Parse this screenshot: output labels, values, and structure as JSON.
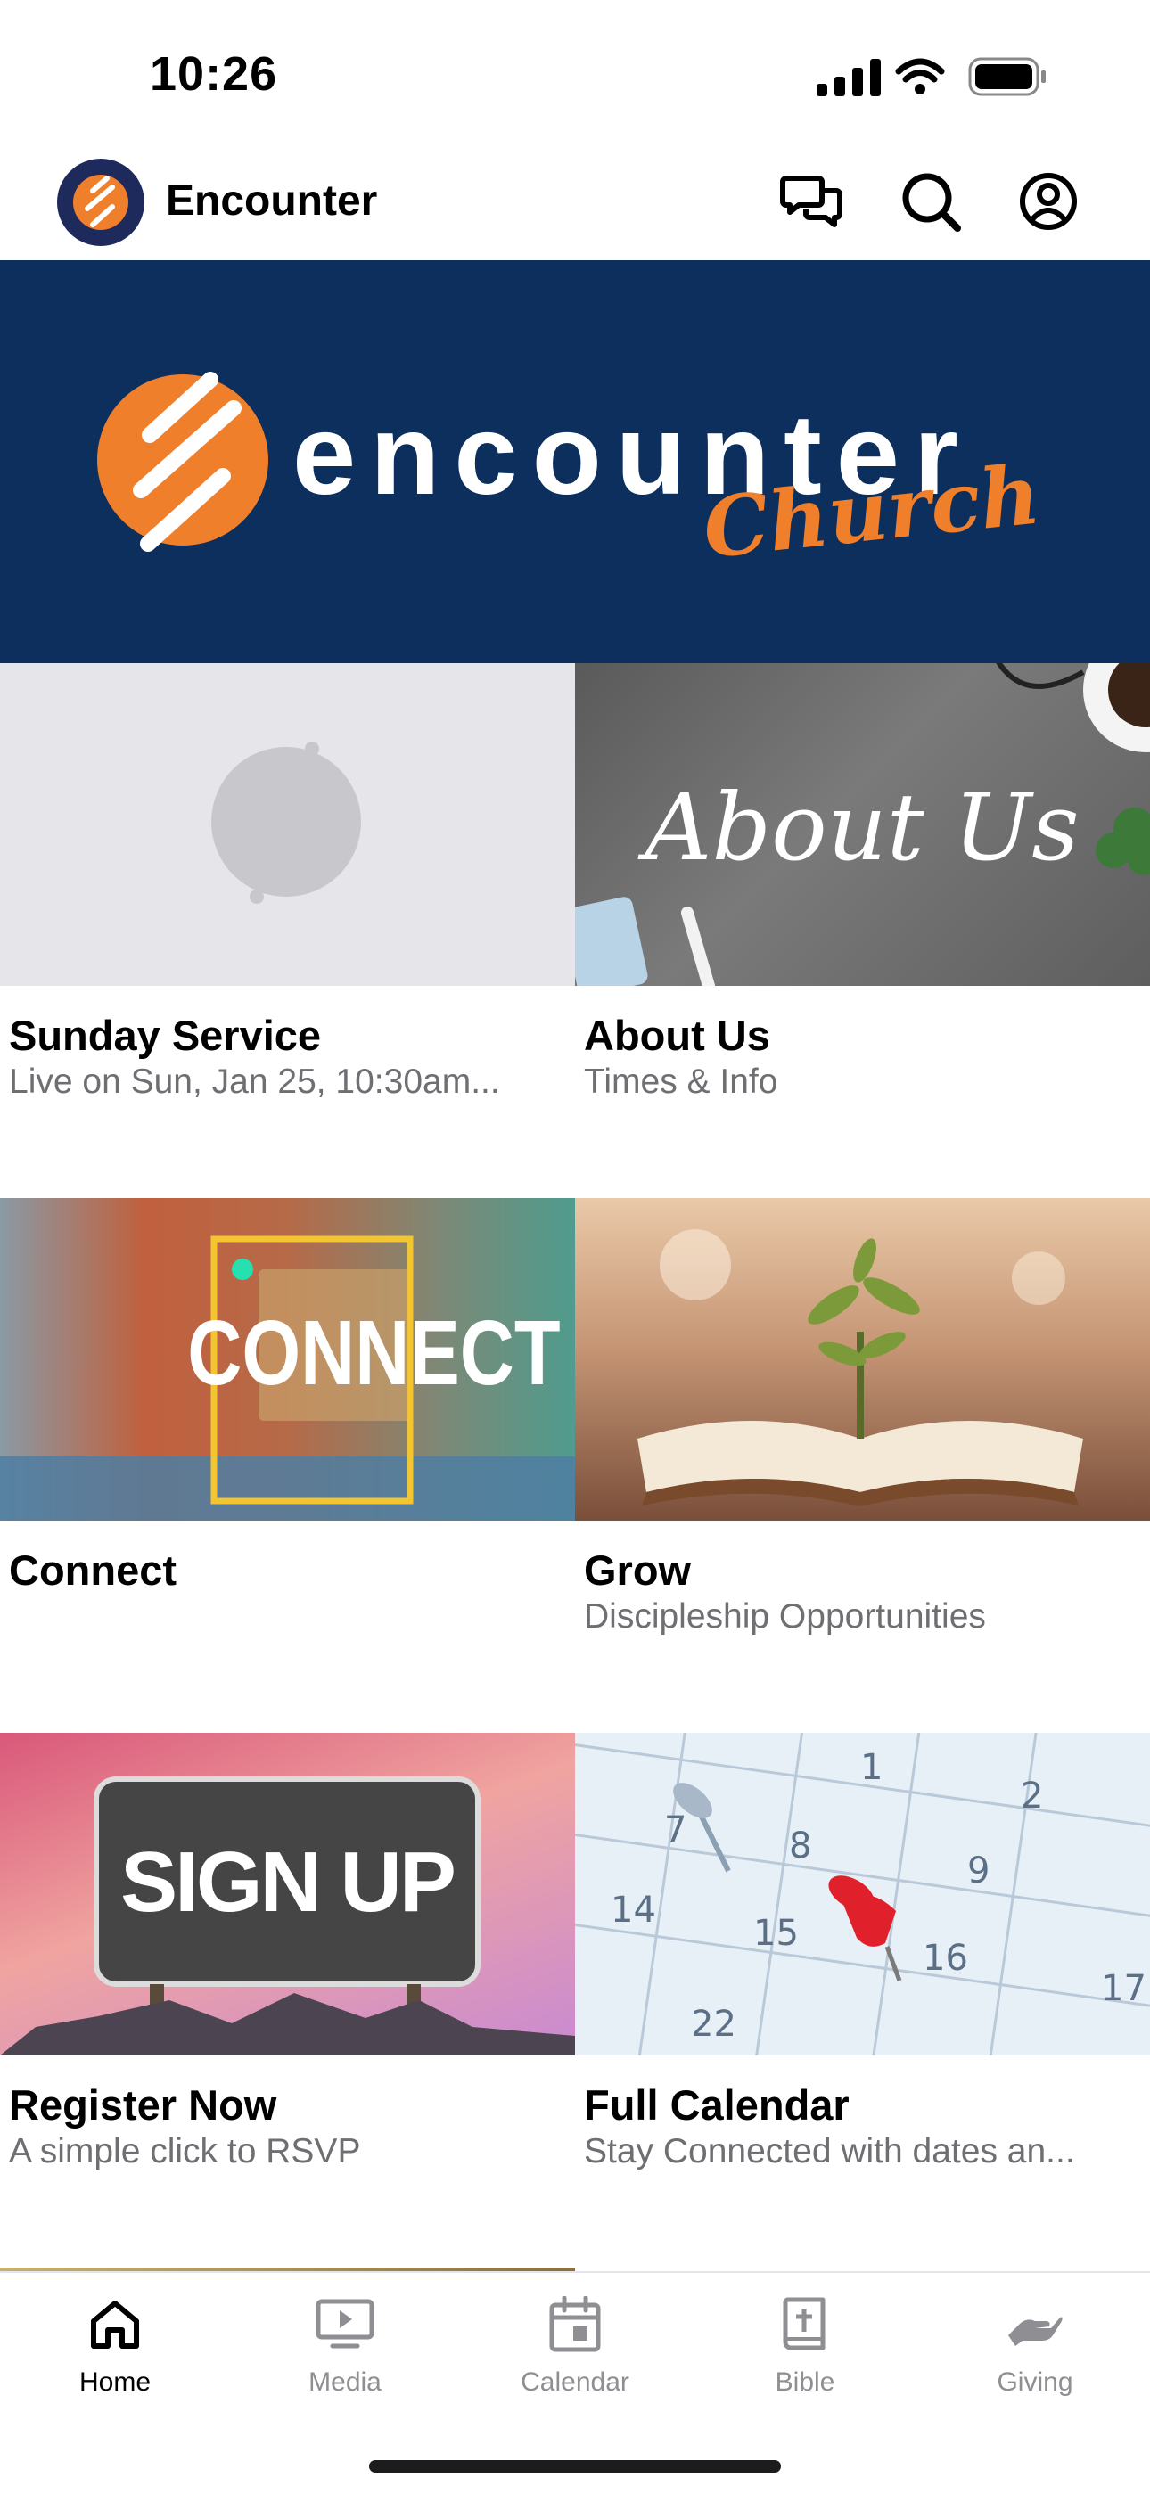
{
  "status_bar": {
    "time": "10:26"
  },
  "header": {
    "app_title": "Encounter"
  },
  "banner": {
    "word": "encounter",
    "script_word": "Church",
    "brand_orange": "#f07f2c",
    "brand_navy": "#0c2f5e"
  },
  "tiles": [
    {
      "title": "Sunday Service",
      "subtitle": "Live on Sun, Jan 25, 10:30am..."
    },
    {
      "title": "About Us",
      "subtitle": "Times & Info",
      "image_text": "About Us"
    },
    {
      "title": "Connect",
      "subtitle": "",
      "image_text": "CONNECT"
    },
    {
      "title": "Grow",
      "subtitle": "Discipleship Opportunities"
    },
    {
      "title": "Register Now",
      "subtitle": "A simple click to RSVP",
      "image_text": "SIGN UP"
    },
    {
      "title": "Full Calendar",
      "subtitle": "Stay Connected with dates an...",
      "calendar_numbers": [
        "1",
        "2",
        "7",
        "8",
        "9",
        "14",
        "15",
        "16",
        "17",
        "22"
      ]
    }
  ],
  "tab_bar": {
    "tabs": [
      {
        "label": "Home",
        "icon": "home-icon",
        "active": true
      },
      {
        "label": "Media",
        "icon": "play-screen-icon",
        "active": false
      },
      {
        "label": "Calendar",
        "icon": "calendar-icon",
        "active": false
      },
      {
        "label": "Bible",
        "icon": "bible-icon",
        "active": false
      },
      {
        "label": "Giving",
        "icon": "giving-icon",
        "active": false
      }
    ]
  }
}
